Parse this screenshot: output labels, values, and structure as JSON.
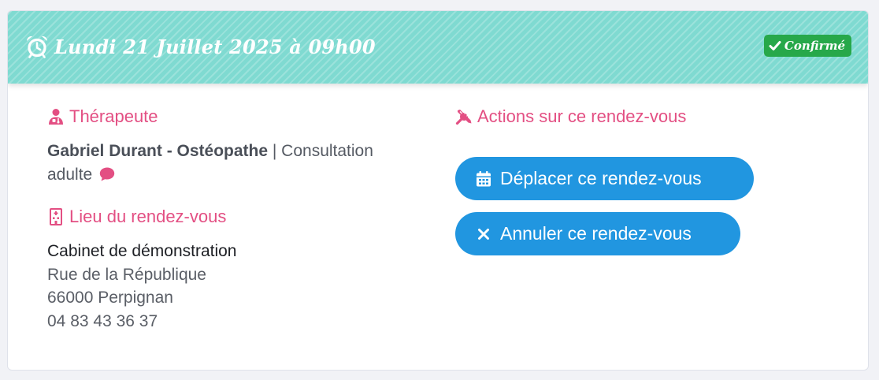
{
  "appointment": {
    "title": "Lundi 21 Juillet 2025 à 09h00",
    "title_icon": "alarm-clock-icon",
    "status": "Confirmé",
    "status_icon": "check-icon"
  },
  "therapist": {
    "heading": "Thérapeute",
    "heading_icon": "user-doctor-icon",
    "name": "Gabriel Durant - Ostéopathe",
    "separator": " | ",
    "service": "Consultation adulte",
    "comment_icon": "comment-icon"
  },
  "location": {
    "heading": "Lieu du rendez-vous",
    "heading_icon": "hospital-building-icon",
    "name": "Cabinet de démonstration",
    "street": "Rue de la République",
    "city": "66000 Perpignan",
    "phone": "04 83 43 36 37"
  },
  "actions": {
    "heading": "Actions sur ce rendez-vous",
    "heading_icon": "tools-icon",
    "move_label": "Déplacer ce rendez-vous",
    "move_icon": "calendar-icon",
    "cancel_label": "Annuler ce rendez-vous",
    "cancel_icon": "close-icon"
  },
  "colors": {
    "header_bg": "#7fdad1",
    "accent_pink": "#e34f83",
    "button_blue": "#2196e0",
    "status_green": "#27a84a"
  }
}
